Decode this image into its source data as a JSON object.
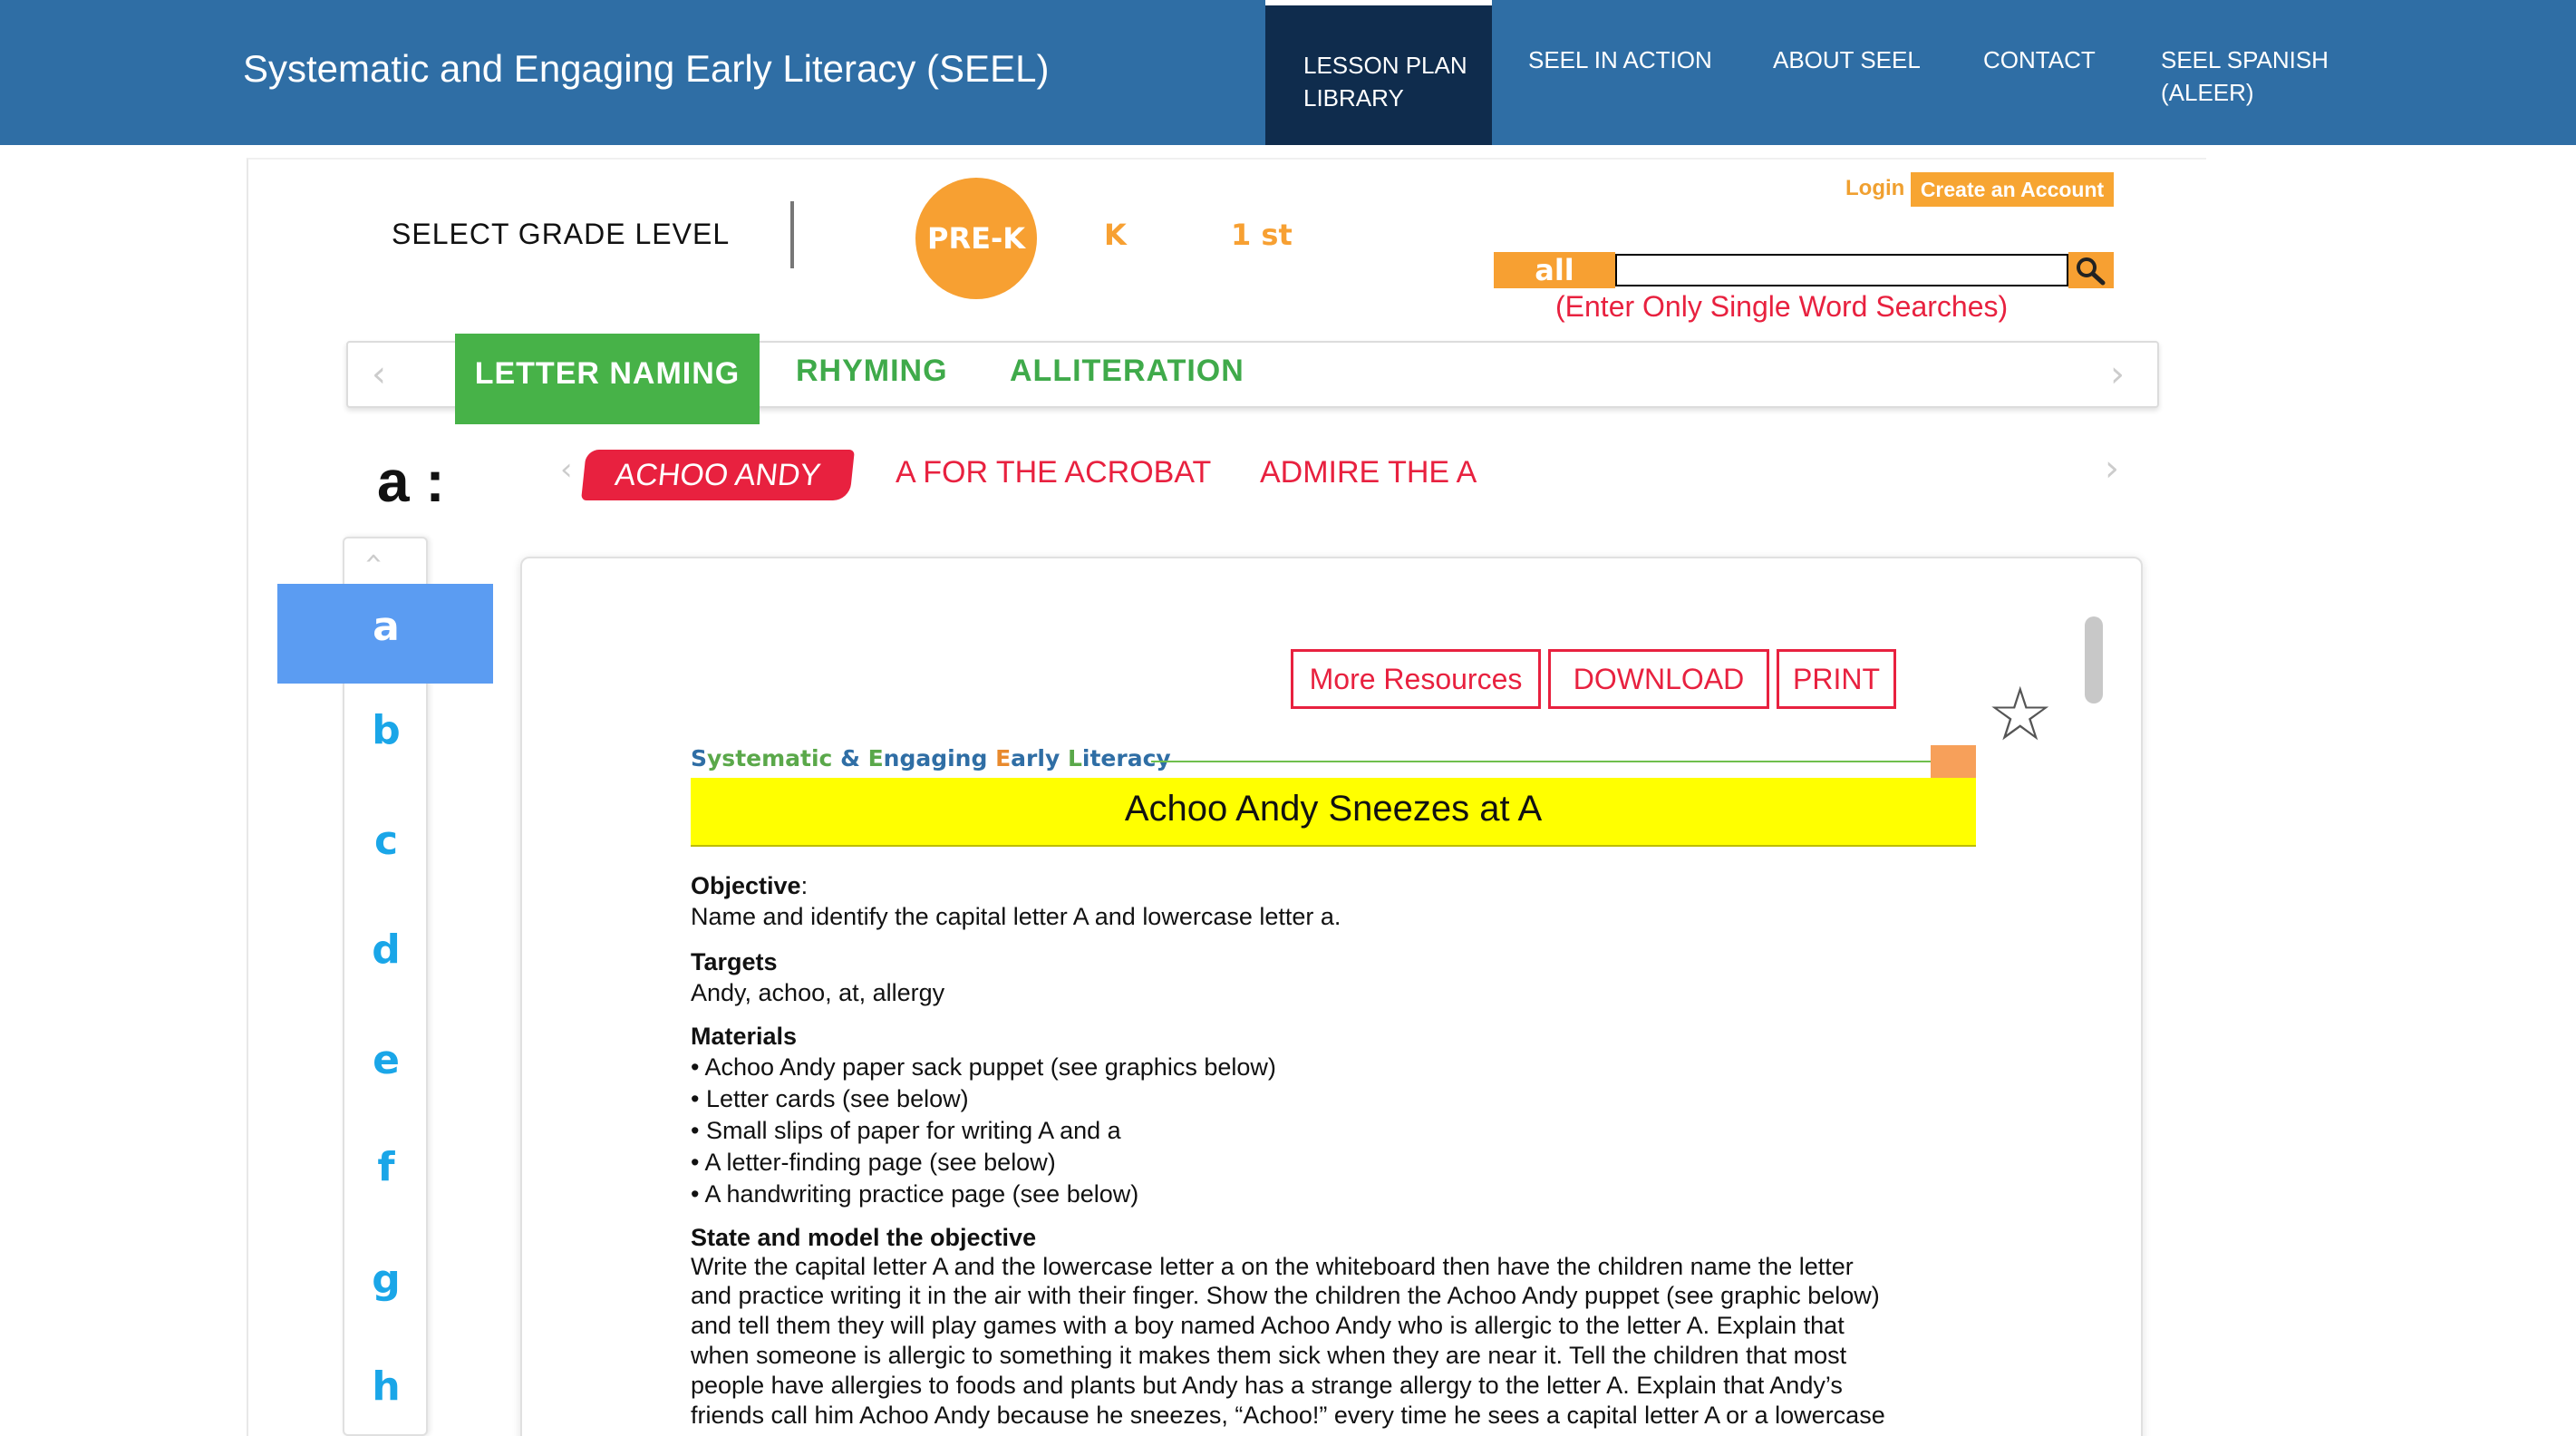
{
  "site": {
    "title": "Systematic and Engaging Early Literacy (SEEL)"
  },
  "nav": {
    "items": [
      {
        "label": "LESSON PLAN\nLIBRARY"
      },
      {
        "label": "SEEL IN ACTION"
      },
      {
        "label": "ABOUT SEEL"
      },
      {
        "label": "CONTACT"
      },
      {
        "label": "SEEL SPANISH\n(ALEER)"
      }
    ]
  },
  "account": {
    "login": "Login",
    "create": "Create an Account"
  },
  "grade": {
    "label": "SELECT GRADE LEVEL",
    "options": [
      "PRE-K",
      "K",
      "1 st"
    ],
    "selected": "PRE-K"
  },
  "search": {
    "scope": "all",
    "value": "",
    "hint": "(Enter Only Single Word Searches)"
  },
  "tabs": [
    "LETTER NAMING",
    "RHYMING",
    "ALLITERATION"
  ],
  "lessons": {
    "letter": "a :",
    "items": [
      "ACHOO ANDY",
      "A FOR THE ACROBAT",
      "ADMIRE THE A"
    ]
  },
  "sidebar": {
    "letters": [
      "a",
      "b",
      "c",
      "d",
      "e",
      "f",
      "g",
      "h"
    ],
    "active": "a"
  },
  "buttons": {
    "resources": "More Resources",
    "download": "DOWNLOAD",
    "print": "PRINT"
  },
  "doc": {
    "brand_parts": [
      {
        "t": "S",
        "c": "#2f6ea5"
      },
      {
        "t": "ystematic ",
        "c": "#5aa84a"
      },
      {
        "t": "& ",
        "c": "#2f6ea5"
      },
      {
        "t": "E",
        "c": "#5aa84a"
      },
      {
        "t": "ngaging ",
        "c": "#2f6ea5"
      },
      {
        "t": "E",
        "c": "#e88a2e"
      },
      {
        "t": "arly ",
        "c": "#2f6ea5"
      },
      {
        "t": "L",
        "c": "#5aa84a"
      },
      {
        "t": "iteracy",
        "c": "#2f6ea5"
      }
    ],
    "title": "Achoo Andy Sneezes at A",
    "objective_head": "Objective",
    "objective_colon": ":",
    "objective_text": "Name and identify the capital letter A and lowercase letter a.",
    "targets_head": "Targets",
    "targets_text": "Andy, achoo, at, allergy",
    "materials_head": "Materials",
    "materials": [
      "• Achoo Andy paper sack puppet (see graphics below)",
      "• Letter cards (see below)",
      "• Small slips of paper for writing A and a",
      "• A letter-finding page (see below)",
      "• A handwriting practice page (see below)"
    ],
    "state_head": "State and model the objective",
    "state_lines": [
      "Write the capital letter A and the lowercase letter a on the whiteboard then have the children name the letter",
      "and practice writing it in the air with their finger. Show the children the Achoo Andy puppet (see graphic below)",
      "and tell them they will play games with a boy named Achoo Andy who is allergic to the letter A. Explain that",
      "when someone is allergic to something it makes them sick when they are near it. Tell the children that most",
      "people have allergies to foods and plants but Andy has a strange allergy to the letter A. Explain that Andy’s",
      "friends call him Achoo Andy because he sneezes, “Achoo!” every time he sees a capital letter A or a lowercase"
    ]
  }
}
